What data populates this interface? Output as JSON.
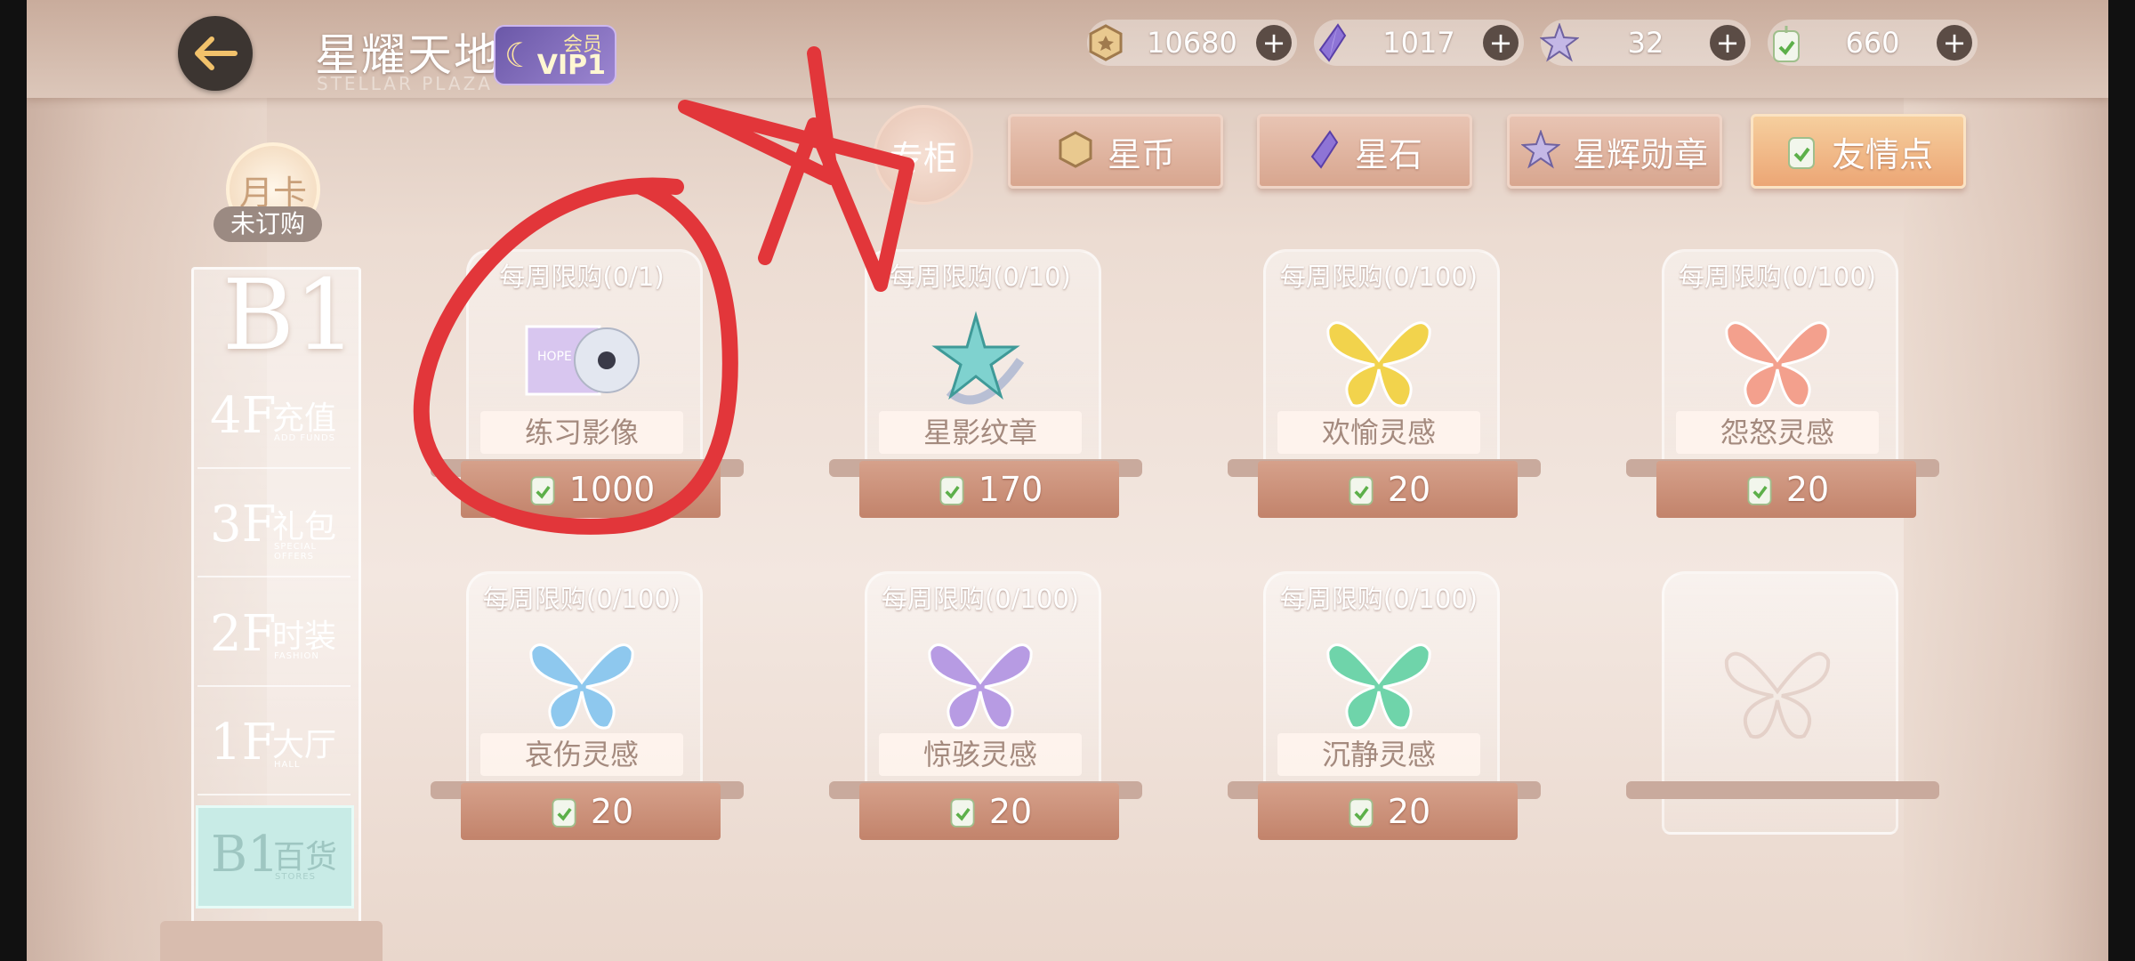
{
  "header": {
    "title": "星耀天地",
    "subtitle": "STELLAR PLAZA",
    "vip_top": "会员",
    "vip_level": "VIP1"
  },
  "currencies": [
    {
      "icon": "star-coin-icon",
      "value": "10680",
      "plus": "+"
    },
    {
      "icon": "star-stone-icon",
      "value": "1017",
      "plus": "+"
    },
    {
      "icon": "star-medal-icon",
      "value": "32",
      "plus": "+"
    },
    {
      "icon": "friendship-point-icon",
      "value": "660",
      "plus": "+"
    }
  ],
  "cabinet_label": "专柜",
  "tabs": [
    {
      "label": "星币",
      "icon": "star-coin-icon",
      "active": false
    },
    {
      "label": "星石",
      "icon": "star-stone-icon",
      "active": false
    },
    {
      "label": "星辉勋章",
      "icon": "star-medal-icon",
      "active": false
    },
    {
      "label": "友情点",
      "icon": "friendship-point-icon",
      "active": true
    }
  ],
  "month_card": {
    "label": "月卡",
    "status": "未订购"
  },
  "floors": {
    "current": "B1",
    "items": [
      {
        "num": "4F",
        "cn": "充值",
        "en": "ADD FUNDS"
      },
      {
        "num": "3F",
        "cn": "礼包",
        "en": "SPECIAL OFFERS"
      },
      {
        "num": "2F",
        "cn": "时装",
        "en": "FASHION"
      },
      {
        "num": "1F",
        "cn": "大厅",
        "en": "HALL"
      },
      {
        "num": "B1",
        "cn": "百货",
        "en": "STORES"
      }
    ]
  },
  "items": [
    {
      "limit": "每周限购(0/1)",
      "name": "练习影像",
      "price": "1000",
      "icon": "practice-video-disc-icon"
    },
    {
      "limit": "每周限购(0/10)",
      "name": "星影纹章",
      "price": "170",
      "icon": "star-emblem-icon"
    },
    {
      "limit": "每周限购(0/100)",
      "name": "欢愉灵感",
      "price": "20",
      "icon": "yellow-butterfly-icon",
      "color": "#f2d34c"
    },
    {
      "limit": "每周限购(0/100)",
      "name": "怨怒灵感",
      "price": "20",
      "icon": "red-butterfly-icon",
      "color": "#f3a08d"
    },
    {
      "limit": "每周限购(0/100)",
      "name": "哀伤灵感",
      "price": "20",
      "icon": "blue-butterfly-icon",
      "color": "#8ec8ee"
    },
    {
      "limit": "每周限购(0/100)",
      "name": "惊骇灵感",
      "price": "20",
      "icon": "purple-butterfly-icon",
      "color": "#b79be3"
    },
    {
      "limit": "每周限购(0/100)",
      "name": "沉静灵感",
      "price": "20",
      "icon": "green-butterfly-icon",
      "color": "#6fd4aa"
    }
  ]
}
